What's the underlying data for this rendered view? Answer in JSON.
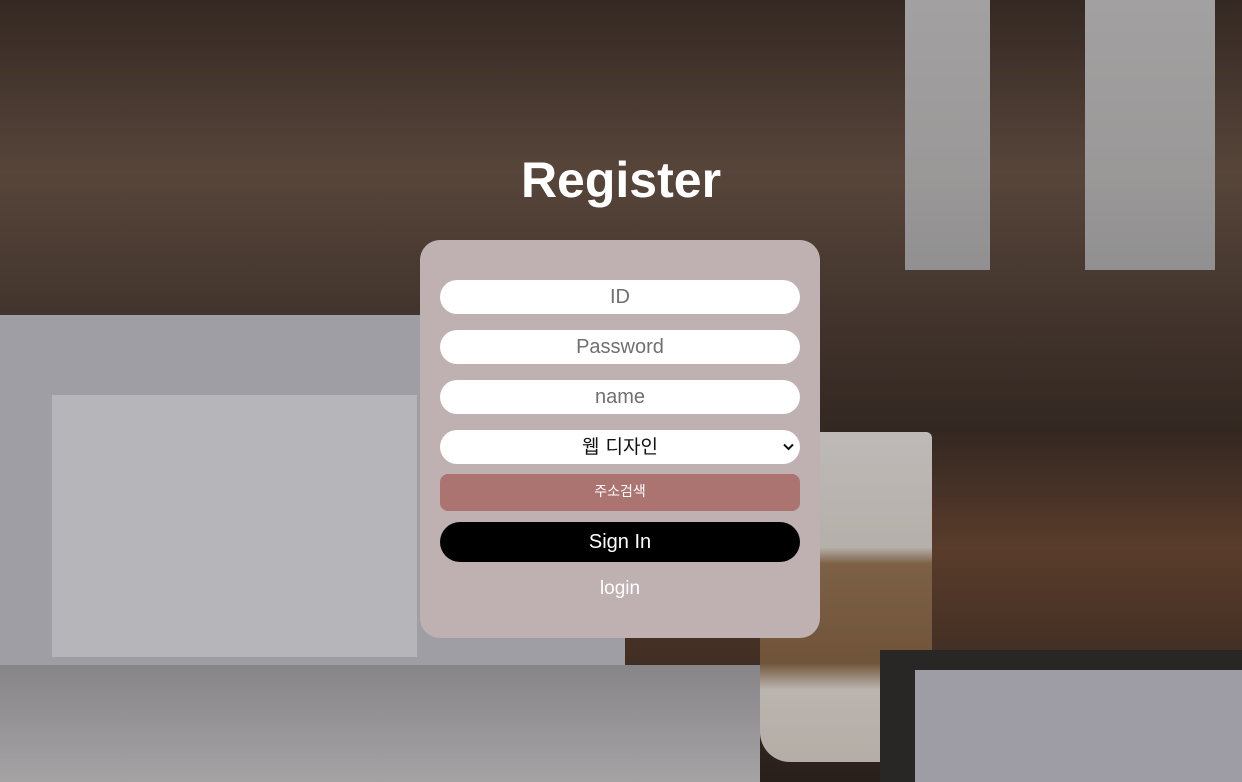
{
  "page": {
    "title": "Register"
  },
  "form": {
    "id_placeholder": "ID",
    "password_placeholder": "Password",
    "name_placeholder": "name",
    "category_selected": "웹 디자인",
    "address_button": "주소검색",
    "signin_button": "Sign In",
    "login_link": "login"
  },
  "icons": {
    "select_arrow": "chevron-down-icon"
  },
  "colors": {
    "card_bg": "#bfb1b1",
    "address_button_bg": "#ac7471",
    "signin_button_bg": "#000000"
  }
}
